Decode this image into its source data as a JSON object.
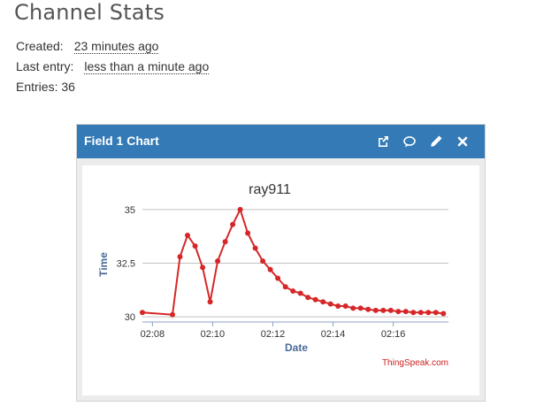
{
  "page": {
    "title": "Channel Stats",
    "created_label": "Created:",
    "created_value": "23 minutes ago",
    "last_entry_label": "Last entry:",
    "last_entry_value": "less than a minute ago",
    "entries_label": "Entries:",
    "entries_value": "36"
  },
  "panel": {
    "title": "Field 1 Chart",
    "icons": [
      "external-link-icon",
      "comment-icon",
      "pencil-icon",
      "close-icon"
    ],
    "header_color": "#337ab7"
  },
  "chart_data": {
    "type": "line",
    "title": "ray911",
    "xlabel": "Date",
    "ylabel": "Time",
    "credit": "ThingSpeak.com",
    "series_color": "#d62728",
    "xlim": [
      "02:07:40",
      "02:17:50"
    ],
    "ylim": [
      29.8,
      35.2
    ],
    "yticks": [
      30,
      32.5,
      35
    ],
    "ytick_labels": [
      "30",
      "32.5",
      "35"
    ],
    "xticks": [
      "02:08",
      "02:10",
      "02:12",
      "02:14",
      "02:16"
    ],
    "grid": true,
    "legend": false,
    "series": [
      {
        "x": [
          "02:07:40",
          "02:08:40",
          "02:08:55",
          "02:09:10",
          "02:09:25",
          "02:09:40",
          "02:09:55",
          "02:10:10",
          "02:10:25",
          "02:10:40",
          "02:10:55",
          "02:11:10",
          "02:11:25",
          "02:11:40",
          "02:11:55",
          "02:12:10",
          "02:12:25",
          "02:12:40",
          "02:12:55",
          "02:13:10",
          "02:13:25",
          "02:13:40",
          "02:13:55",
          "02:14:10",
          "02:14:25",
          "02:14:40",
          "02:14:55",
          "02:15:10",
          "02:15:25",
          "02:15:40",
          "02:15:55",
          "02:16:10",
          "02:16:25",
          "02:16:40",
          "02:16:55",
          "02:17:10",
          "02:17:25",
          "02:17:40"
        ],
        "y": [
          30.2,
          30.1,
          32.8,
          33.8,
          33.3,
          32.3,
          30.7,
          32.6,
          33.5,
          34.3,
          35.0,
          33.9,
          33.2,
          32.6,
          32.2,
          31.8,
          31.4,
          31.2,
          31.1,
          30.9,
          30.8,
          30.7,
          30.6,
          30.5,
          30.5,
          30.4,
          30.4,
          30.35,
          30.3,
          30.3,
          30.3,
          30.25,
          30.25,
          30.2,
          30.2,
          30.2,
          30.2,
          30.15
        ]
      }
    ]
  }
}
